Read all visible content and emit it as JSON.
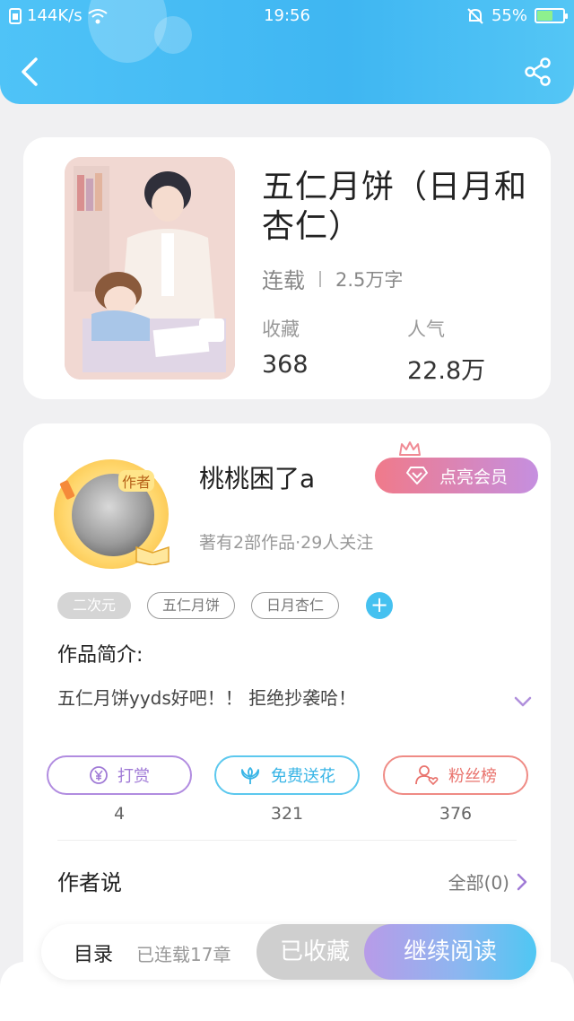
{
  "status_bar": {
    "speed": "144K/s",
    "time": "19:56",
    "battery": "55%",
    "battery_level": 0.55
  },
  "book": {
    "title": "五仁月饼（日月和杏仁）",
    "status": "连载",
    "words": "2.5万字",
    "collect_label": "收藏",
    "collect_value": "368",
    "popularity_label": "人气",
    "popularity_value": "22.8万"
  },
  "author": {
    "tag": "作者",
    "name": "桃桃困了a",
    "meta": "著有2部作品·29人关注",
    "vip_label": "点亮会员"
  },
  "tags": [
    "二次元",
    "五仁月饼",
    "日月杏仁"
  ],
  "intro": {
    "label": "作品简介:",
    "text": "五仁月饼yyds好吧！！ 拒绝抄袭哈！"
  },
  "actions": [
    {
      "label": "打赏",
      "count": "4",
      "icon": "yen-coin-icon"
    },
    {
      "label": "免费送花",
      "count": "321",
      "icon": "flower-icon"
    },
    {
      "label": "粉丝榜",
      "count": "376",
      "icon": "user-heart-icon"
    }
  ],
  "author_says": {
    "label": "作者说",
    "all_label": "全部(0)"
  },
  "bottom_bar": {
    "toc_label": "目录",
    "toc_count": "已连载17章",
    "collected_label": "已收藏",
    "continue_label": "继续阅读"
  },
  "colors": {
    "header": "#4fc3f7",
    "vip_start": "#f07a8a",
    "vip_end": "#c58fe0",
    "reward": "#a07ad6",
    "flower": "#39b5e6",
    "fans": "#e9736d"
  }
}
